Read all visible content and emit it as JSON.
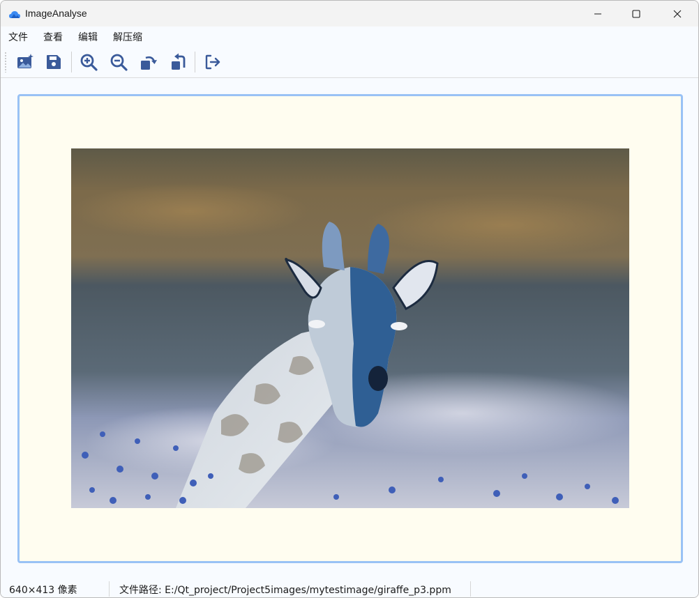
{
  "window": {
    "title": "ImageAnalyse",
    "controls": {
      "minimize": "minimize-icon",
      "maximize": "maximize-icon",
      "close": "close-icon"
    }
  },
  "menu": {
    "items": [
      {
        "label": "文件"
      },
      {
        "label": "查看"
      },
      {
        "label": "编辑"
      },
      {
        "label": "解压缩"
      }
    ]
  },
  "toolbar": {
    "buttons": [
      {
        "icon": "open-image-icon"
      },
      {
        "icon": "save-icon"
      },
      {
        "icon": "zoom-in-icon"
      },
      {
        "icon": "zoom-out-icon"
      },
      {
        "icon": "rotate-right-icon"
      },
      {
        "icon": "rotate-left-icon"
      },
      {
        "icon": "exit-icon"
      }
    ],
    "accent": "#3a5a9a"
  },
  "viewer": {
    "frame_border": "#99c2f5",
    "frame_background": "#fffdf0",
    "image_subject": "inverted-color giraffe photo"
  },
  "status": {
    "size": "640×413 像素",
    "path": "文件路径: E:/Qt_project/Project5images/mytestimage/giraffe_p3.ppm"
  }
}
